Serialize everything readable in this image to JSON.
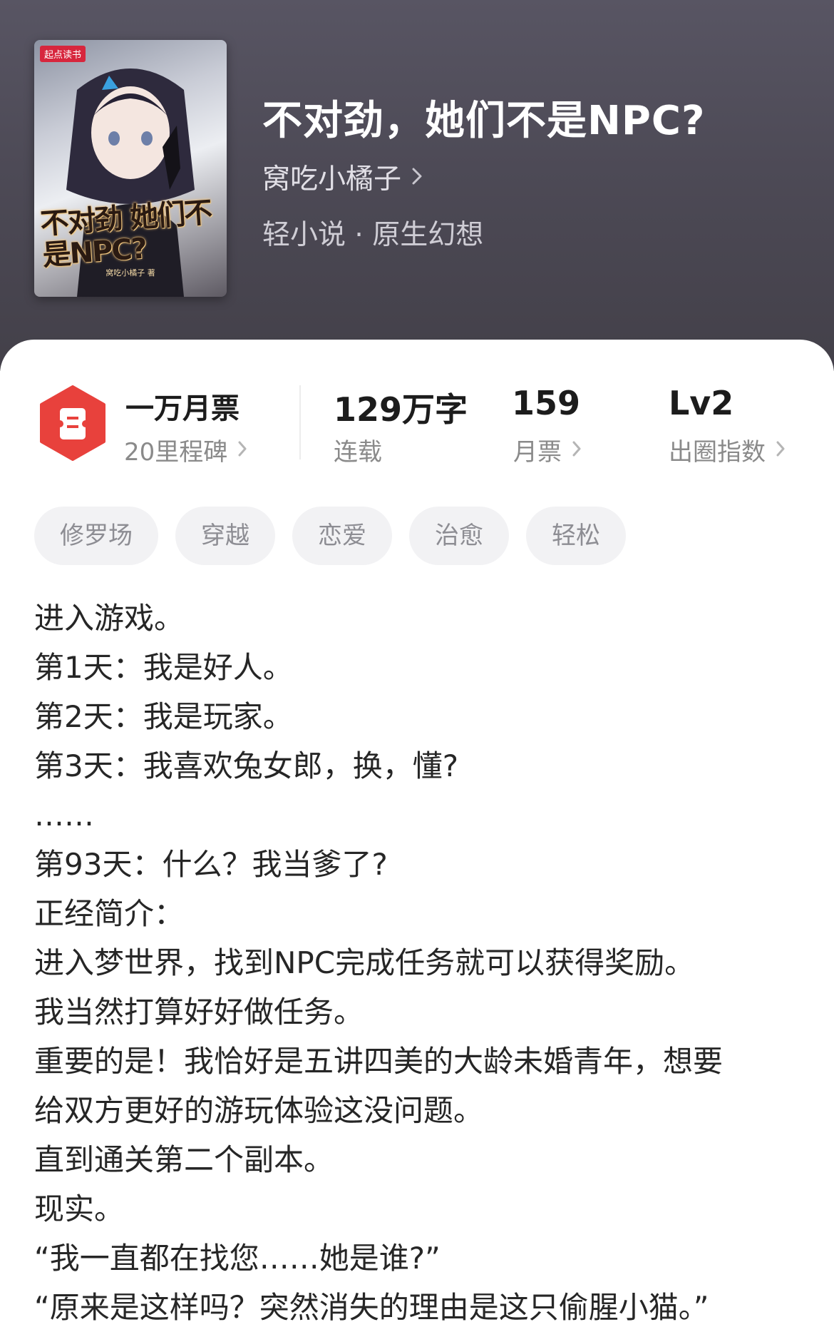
{
  "book": {
    "title": "不对劲，她们不是NPC?",
    "author": "窝吃小橘子",
    "genre": "轻小说 · 原生幻想",
    "cover": {
      "brand": "起点读书",
      "title": "不对劲 她们不是NPC?",
      "author": "窝吃小橘子 著"
    }
  },
  "stats": {
    "ticket_title": "一万月票",
    "ticket_sub": "20里程碑",
    "words_value": "129万字",
    "words_sub": "连载",
    "votes_value": "159",
    "votes_sub": "月票",
    "level_value": "Lv2",
    "level_sub": "出圈指数"
  },
  "tags": [
    "修罗场",
    "穿越",
    "恋爱",
    "治愈",
    "轻松"
  ],
  "synopsis": [
    "进入游戏。",
    "第1天：我是好人。",
    "第2天：我是玩家。",
    "第3天：我喜欢兔女郎，换，懂?",
    "……",
    "第93天：什么？我当爹了?",
    "正经简介：",
    "进入梦世界，找到NPC完成任务就可以获得奖励。",
    "我当然打算好好做任务。",
    "重要的是！我恰好是五讲四美的大龄未婚青年，想要",
    "给双方更好的游玩体验这没问题。",
    "直到通关第二个副本。",
    "现实。",
    "“我一直都在找您……她是谁?”",
    "“原来是这样吗？突然消失的理由是这只偷腥小猫。”"
  ],
  "colors": {
    "header_bg": "#4d4a56",
    "ticket_red": "#e8413c",
    "tag_bg": "#f2f2f4"
  }
}
